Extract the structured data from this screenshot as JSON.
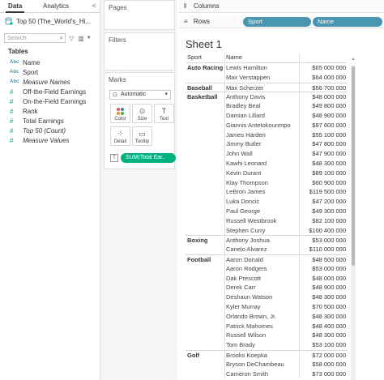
{
  "data_pane": {
    "tab_data": "Data",
    "tab_analytics": "Analytics",
    "collapse_glyph": "<",
    "source_name": "Top 50 (The_World's_Hi...",
    "search_placeholder": "Search",
    "tables_heading": "Tables",
    "fields": [
      {
        "type": "Abc",
        "name": "Name",
        "italic": false
      },
      {
        "type": "Abc",
        "name": "Sport",
        "italic": false
      },
      {
        "type": "Abc",
        "name": "Measure Names",
        "italic": true
      },
      {
        "type": "#",
        "name": "Off-the-Field Earnings",
        "italic": false
      },
      {
        "type": "#",
        "name": "On-the-Field Earnings",
        "italic": false
      },
      {
        "type": "#",
        "name": "Rank",
        "italic": false
      },
      {
        "type": "#",
        "name": "Total Earnings",
        "italic": false
      },
      {
        "type": "#",
        "name": "Top 50 (Count)",
        "italic": true
      },
      {
        "type": "#",
        "name": "Measure Values",
        "italic": true
      }
    ]
  },
  "shelves": {
    "pages": "Pages",
    "filters": "Filters",
    "marks": "Marks",
    "mark_type": "Automatic",
    "color": "Color",
    "size": "Size",
    "text": "Text",
    "detail": "Detail",
    "tooltip": "Tooltip",
    "text_pill": "SUM(Total Ear..",
    "columns": "Columns",
    "rows": "Rows",
    "row_pills": [
      "Sport",
      "Name"
    ]
  },
  "view": {
    "title": "Sheet 1",
    "col_sport": "Sport",
    "col_name": "Name",
    "rows": [
      {
        "sport": "Auto Racing",
        "name": "Lewis Hamilton",
        "value": "$65 000 000"
      },
      {
        "sport": "",
        "name": "Max Verstappen",
        "value": "$64 000 000"
      },
      {
        "sport": "Baseball",
        "name": "Max Scherzer",
        "value": "$56 700 000"
      },
      {
        "sport": "Basketball",
        "name": "Anthony Davis",
        "value": "$48 000 000"
      },
      {
        "sport": "",
        "name": "Bradley Beal",
        "value": "$49 800 000"
      },
      {
        "sport": "",
        "name": "Damian Lillard",
        "value": "$48 900 000"
      },
      {
        "sport": "",
        "name": "Giannis Antetokounmpo",
        "value": "$87 600 000"
      },
      {
        "sport": "",
        "name": "James Harden",
        "value": "$55 100 000"
      },
      {
        "sport": "",
        "name": "Jimmy Butler",
        "value": "$47 800 000"
      },
      {
        "sport": "",
        "name": "John Wall",
        "value": "$47 900 000"
      },
      {
        "sport": "",
        "name": "Kawhi Leonard",
        "value": "$48 300 000"
      },
      {
        "sport": "",
        "name": "Kevin Durant",
        "value": "$89 100 000"
      },
      {
        "sport": "",
        "name": "Klay Thompson",
        "value": "$60 900 000"
      },
      {
        "sport": "",
        "name": "LeBron James",
        "value": "$119 500 000"
      },
      {
        "sport": "",
        "name": "Luka Doncic",
        "value": "$47 200 000"
      },
      {
        "sport": "",
        "name": "Paul George",
        "value": "$49 300 000"
      },
      {
        "sport": "",
        "name": "Russell Westbrook",
        "value": "$82 100 000"
      },
      {
        "sport": "",
        "name": "Stephen Curry",
        "value": "$100 400 000"
      },
      {
        "sport": "Boxing",
        "name": "Anthony Joshua",
        "value": "$53 000 000"
      },
      {
        "sport": "",
        "name": "Canelo Alvarez",
        "value": "$110 000 000"
      },
      {
        "sport": "Football",
        "name": "Aaron Donald",
        "value": "$48 500 000"
      },
      {
        "sport": "",
        "name": "Aaron Rodgers",
        "value": "$53 000 000"
      },
      {
        "sport": "",
        "name": "Dak Prescott",
        "value": "$48 000 000"
      },
      {
        "sport": "",
        "name": "Derek Carr",
        "value": "$48 900 000"
      },
      {
        "sport": "",
        "name": "Deshaun Watson",
        "value": "$48 300 000"
      },
      {
        "sport": "",
        "name": "Kyler Murray",
        "value": "$70 500 000"
      },
      {
        "sport": "",
        "name": "Orlando Brown, Jr.",
        "value": "$48 300 000"
      },
      {
        "sport": "",
        "name": "Patrick Mahomes",
        "value": "$48 400 000"
      },
      {
        "sport": "",
        "name": "Russell Wilson",
        "value": "$48 300 000"
      },
      {
        "sport": "",
        "name": "Tom Brady",
        "value": "$53 100 000"
      },
      {
        "sport": "Golf",
        "name": "Brooks Koepka",
        "value": "$72 000 000"
      },
      {
        "sport": "",
        "name": "Bryson DeChambeau",
        "value": "$58 000 000"
      },
      {
        "sport": "",
        "name": "Cameron Smith",
        "value": "$73 000 000"
      }
    ]
  }
}
